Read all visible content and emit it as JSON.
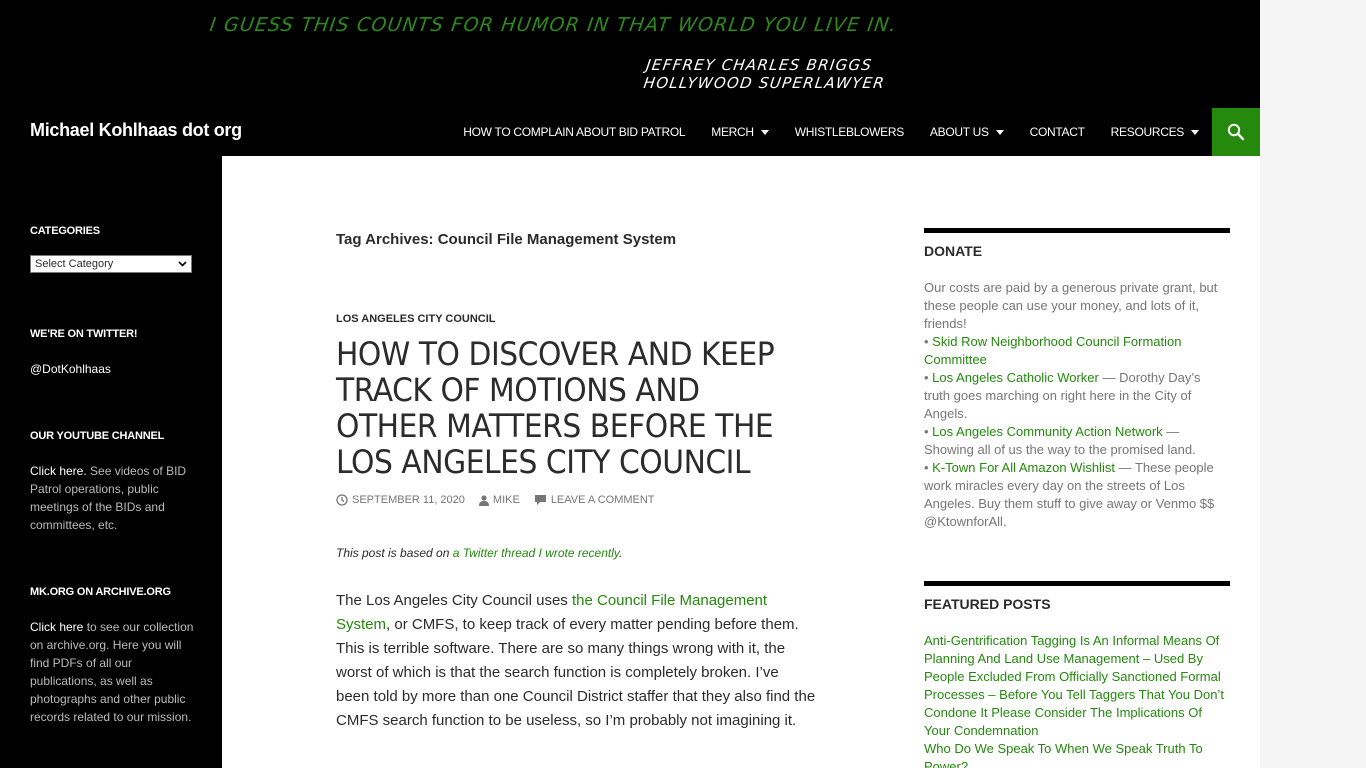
{
  "banner": {
    "quote": "I guess this counts for humor in that world you live in.",
    "attribution_line1": "Jeffrey Charles Briggs",
    "attribution_line2": "Hollywood Superlawyer"
  },
  "site": {
    "title": "Michael Kohlhaas dot org",
    "social": [
      {
        "name": "facebook-icon",
        "glyph": "f",
        "color": "#1877f2"
      },
      {
        "name": "twitter-icon",
        "glyph": "t",
        "color": "#1da1f2"
      },
      {
        "name": "reddit-icon",
        "glyph": "r",
        "color": "#ff4500"
      },
      {
        "name": "share-plus-icon",
        "glyph": "+",
        "color": "#0166ff"
      }
    ]
  },
  "nav": {
    "items": [
      {
        "label": "HOW TO COMPLAIN ABOUT BID PATROL",
        "dropdown": false
      },
      {
        "label": "MERCH",
        "dropdown": true
      },
      {
        "label": "WHISTLEBLOWERS",
        "dropdown": false
      },
      {
        "label": "ABOUT US",
        "dropdown": true
      },
      {
        "label": "CONTACT",
        "dropdown": false
      },
      {
        "label": "RESOURCES",
        "dropdown": true
      }
    ],
    "search_icon": "search-icon",
    "accent": "#24890d"
  },
  "left_sidebar": {
    "categories": {
      "title": "CATEGORIES",
      "select_value": "Select Category"
    },
    "twitter": {
      "title": "WE'RE ON TWITTER!",
      "handle": "@DotKohlhaas"
    },
    "youtube": {
      "title": "OUR YOUTUBE CHANNEL",
      "link": "Click here.",
      "text": " See videos of BID Patrol operations, public meetings of the BIDs and committees, etc."
    },
    "archive": {
      "title": "MK.ORG ON ARCHIVE.ORG",
      "link": "Click here",
      "text": " to see our collection on archive.org. Here you will find PDFs of all our publications, as well as photographs and other public records related to our mission."
    }
  },
  "main": {
    "archive_title": "Tag Archives: Council File Management System",
    "post": {
      "category": "LOS ANGELES CITY COUNCIL",
      "title": "HOW TO DISCOVER AND KEEP TRACK OF MOTIONS AND OTHER MATTERS BEFORE THE LOS ANGELES CITY COUNCIL",
      "date": "SEPTEMBER 11, 2020",
      "author": "MIKE",
      "comment_link": "LEAVE A COMMENT",
      "intro_prefix": "This post is based on ",
      "intro_link": "a Twitter thread I wrote recently",
      "intro_suffix": ".",
      "body_prefix": "The Los Angeles City Council uses ",
      "body_link": "the Council File Management System",
      "body_suffix": ", or CMFS, to keep track of every matter pending before them. This is terrible software. There are so many things wrong with it, the worst of which is that the search function is completely broken. I’ve been told by more than one Council District staffer that they also find the CMFS search function to be useless, so I’m probably not imagining it."
    }
  },
  "right_sidebar": {
    "donate": {
      "title": "DONATE",
      "intro": "Our costs are paid by a generous private grant, but these people can use your money, and lots of it, friends!",
      "items": [
        {
          "link": "Skid Row Neighborhood Council Formation Committee",
          "desc": ""
        },
        {
          "link": "Los Angeles Catholic Worker",
          "desc": " — Dorothy Day’s truth goes marching on right here in the City of Angels."
        },
        {
          "link": "Los Angeles Community Action Network",
          "desc": " — Showing all of us the way to the promised land."
        },
        {
          "link": "K-Town For All Amazon Wishlist",
          "desc": " — These people work miracles every day on the streets of Los Angeles. Buy them stuff to give away or Venmo $$ @KtownforAll."
        }
      ]
    },
    "featured": {
      "title": "FEATURED POSTS",
      "posts": [
        "Anti-Gentrification Tagging Is An Informal Means Of Planning And Land Use Management – Used By People Excluded From Officially Sanctioned Formal Processes – Before You Tell Taggers That You Don’t Condone It Please Consider The Implications Of Your Condemnation",
        "Who Do We Speak To When We Speak Truth To Power?"
      ]
    }
  }
}
